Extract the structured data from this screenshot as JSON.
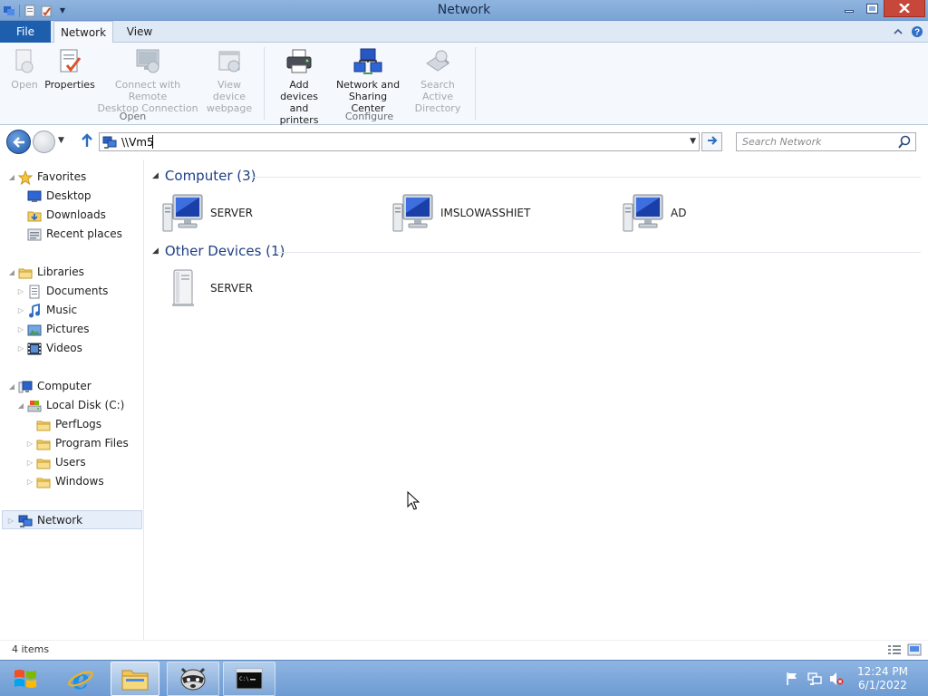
{
  "window": {
    "title": "Network",
    "controls": [
      "minimize",
      "maximize",
      "close"
    ]
  },
  "quick_access_toolbar": {
    "icons": [
      "explorer-icon",
      "properties-icon",
      "new-folder-icon",
      "customize-dropdown-icon"
    ]
  },
  "ribbon": {
    "tabs": [
      "File",
      "Network",
      "View"
    ],
    "active_tab": "Network",
    "groups": [
      {
        "label": "Open",
        "buttons": [
          {
            "label": "Open",
            "icon": "open-icon",
            "enabled": false
          },
          {
            "label": "Properties",
            "icon": "properties-icon",
            "enabled": true
          },
          {
            "label_line1": "Connect with Remote",
            "label_line2": "Desktop Connection",
            "icon": "remote-desktop-icon",
            "enabled": false
          },
          {
            "label_line1": "View device",
            "label_line2": "webpage",
            "icon": "webpage-icon",
            "enabled": false
          }
        ]
      },
      {
        "label": "Configure",
        "buttons": [
          {
            "label_line1": "Add devices",
            "label_line2": "and printers",
            "icon": "printer-icon",
            "enabled": true
          },
          {
            "label_line1": "Network and",
            "label_line2": "Sharing Center",
            "icon": "network-sharing-icon",
            "enabled": true
          },
          {
            "label_line1": "Search Active",
            "label_line2": "Directory",
            "icon": "active-directory-icon",
            "enabled": false
          }
        ]
      }
    ]
  },
  "address_bar": {
    "value": "\\\\Vm5",
    "search_placeholder": "Search Network"
  },
  "nav_pane": {
    "favorites": {
      "label": "Favorites",
      "items": [
        "Desktop",
        "Downloads",
        "Recent places"
      ]
    },
    "libraries": {
      "label": "Libraries",
      "items": [
        "Documents",
        "Music",
        "Pictures",
        "Videos"
      ]
    },
    "computer": {
      "label": "Computer",
      "local_disk": "Local Disk (C:)",
      "folders": [
        "PerfLogs",
        "Program Files",
        "Users",
        "Windows"
      ]
    },
    "network": {
      "label": "Network",
      "selected": true
    }
  },
  "content": {
    "groups": [
      {
        "header": "Computer (3)",
        "items": [
          {
            "name": "SERVER",
            "icon": "computer-icon"
          },
          {
            "name": "IMSLOWASSHIET",
            "icon": "computer-icon"
          },
          {
            "name": "AD",
            "icon": "computer-icon"
          }
        ]
      },
      {
        "header": "Other Devices (1)",
        "items": [
          {
            "name": "SERVER",
            "icon": "device-tower-icon"
          }
        ]
      }
    ]
  },
  "status_bar": {
    "item_count": "4 items"
  },
  "taskbar": {
    "pinned": [
      "start-icon",
      "internet-explorer-icon",
      "file-explorer-icon",
      "raccoon-app-icon",
      "command-prompt-icon"
    ],
    "tray_icons": [
      "action-center-flag-icon",
      "network-status-icon",
      "volume-muted-icon"
    ],
    "time": "12:24 PM",
    "date": "6/1/2022"
  },
  "colors": {
    "accent": "#1e5fad",
    "group_header": "#1e3f83",
    "taskbar": "#7aa4d6"
  }
}
